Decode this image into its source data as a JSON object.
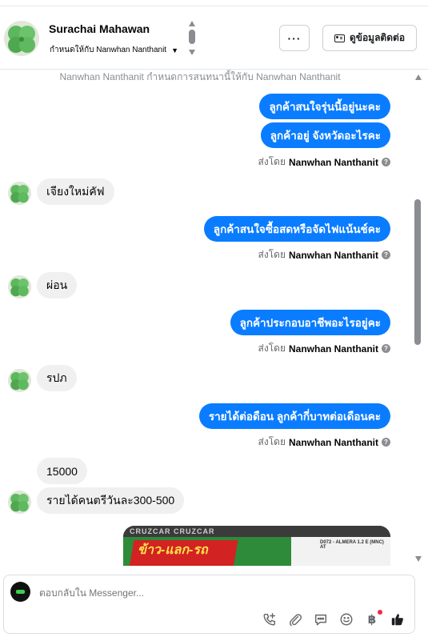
{
  "header": {
    "name": "Surachai Mahawan",
    "assigned_to": "กำหนดให้กับ Nanwhan Nanthanit",
    "more_label": "···",
    "contact_label": "ดูข้อมูลติดต่อ"
  },
  "chat": {
    "system_note": "Nanwhan Nanthanit กำหนดการสนทนานี้ให้กับ Nanwhan Nanthanit",
    "sent_by_prefix": "ส่งโดย",
    "sent_by_name": "Nanwhan Nanthanit",
    "info_glyph": "?",
    "messages": [
      {
        "dir": "out",
        "text": "ลูกค้าสนใจรุ่นนี้อยู่นะคะ"
      },
      {
        "dir": "out",
        "text": "ลูกค้าอยู่ จังหวัดอะไรคะ"
      },
      {
        "dir": "in",
        "text": "เจียงใหม่คัฟ"
      },
      {
        "dir": "out",
        "text": "ลูกค้าสนใจซื้อสดหรือจัดไฟแน้นช์คะ"
      },
      {
        "dir": "in",
        "text": "ผ่อน"
      },
      {
        "dir": "out",
        "text": "ลูกค้าประกอบอาชีพอะไรอยู่คะ"
      },
      {
        "dir": "in",
        "text": "รปภ"
      },
      {
        "dir": "out",
        "text": "รายได้ต่อดือน ลูกค้ากี่บาทต่อเดือนคะ"
      },
      {
        "dir": "in",
        "text": "15000"
      },
      {
        "dir": "in",
        "text": "รายได้คนตรีวันละ300-500"
      }
    ],
    "image_preview": {
      "promo_text": "ข้าว-แลก-รถ",
      "model_text": "D072 - ALMERA 1.2 E (MNC) AT",
      "top_text": "CRUZCAR CRUZCAR"
    }
  },
  "composer": {
    "placeholder": "ตอบกลับใน Messenger...",
    "baht_glyph": "฿",
    "tools": [
      "call-add-icon",
      "attach-icon",
      "saved-reply-icon",
      "emoji-icon",
      "payment-icon",
      "like-icon"
    ]
  }
}
